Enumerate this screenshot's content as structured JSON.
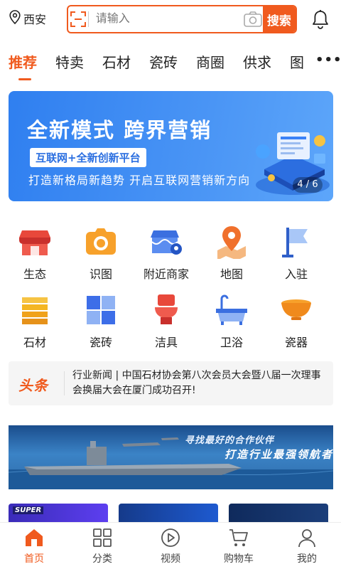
{
  "header": {
    "location": "西安",
    "search_placeholder": "请输入",
    "search_button": "搜索"
  },
  "tabs": [
    {
      "label": "推荐",
      "active": true
    },
    {
      "label": "特卖"
    },
    {
      "label": "石材"
    },
    {
      "label": "瓷砖"
    },
    {
      "label": "商圈"
    },
    {
      "label": "供求"
    },
    {
      "label": "图"
    }
  ],
  "more_label": "•••",
  "banner": {
    "title": "全新模式  跨界营销",
    "badge": "互联网+全新创新平台",
    "subtitle": "打造新格局新趋势  开启互联网营销新方向",
    "page_indicator": "4 / 6"
  },
  "grid": [
    {
      "label": "生态",
      "icon": "shop-icon"
    },
    {
      "label": "识图",
      "icon": "camera-icon"
    },
    {
      "label": "附近商家",
      "icon": "nearby-store-icon"
    },
    {
      "label": "地图",
      "icon": "map-icon"
    },
    {
      "label": "入驻",
      "icon": "flag-icon"
    },
    {
      "label": "石材",
      "icon": "stone-slab-icon"
    },
    {
      "label": "瓷砖",
      "icon": "tile-icon"
    },
    {
      "label": "洁具",
      "icon": "toilet-icon"
    },
    {
      "label": "卫浴",
      "icon": "bathtub-icon"
    },
    {
      "label": "瓷器",
      "icon": "bowl-icon"
    }
  ],
  "news": {
    "tag": "头条",
    "text": "行业新闻 | 中国石材协会第八次会员大会暨八届一次理事会换届大会在厦门成功召开!"
  },
  "ad": {
    "line1": "寻找最好的合作伙伴",
    "line2": "打造行业最强领航者"
  },
  "cards": {
    "first_text": "SUPER"
  },
  "bottom_nav": [
    {
      "label": "首页",
      "icon": "home-icon",
      "active": true
    },
    {
      "label": "分类",
      "icon": "grid-icon"
    },
    {
      "label": "视频",
      "icon": "play-icon"
    },
    {
      "label": "购物车",
      "icon": "cart-icon"
    },
    {
      "label": "我的",
      "icon": "user-icon"
    }
  ],
  "colors": {
    "accent": "#f05a1e",
    "banner_blue": "#2f7ff0"
  }
}
